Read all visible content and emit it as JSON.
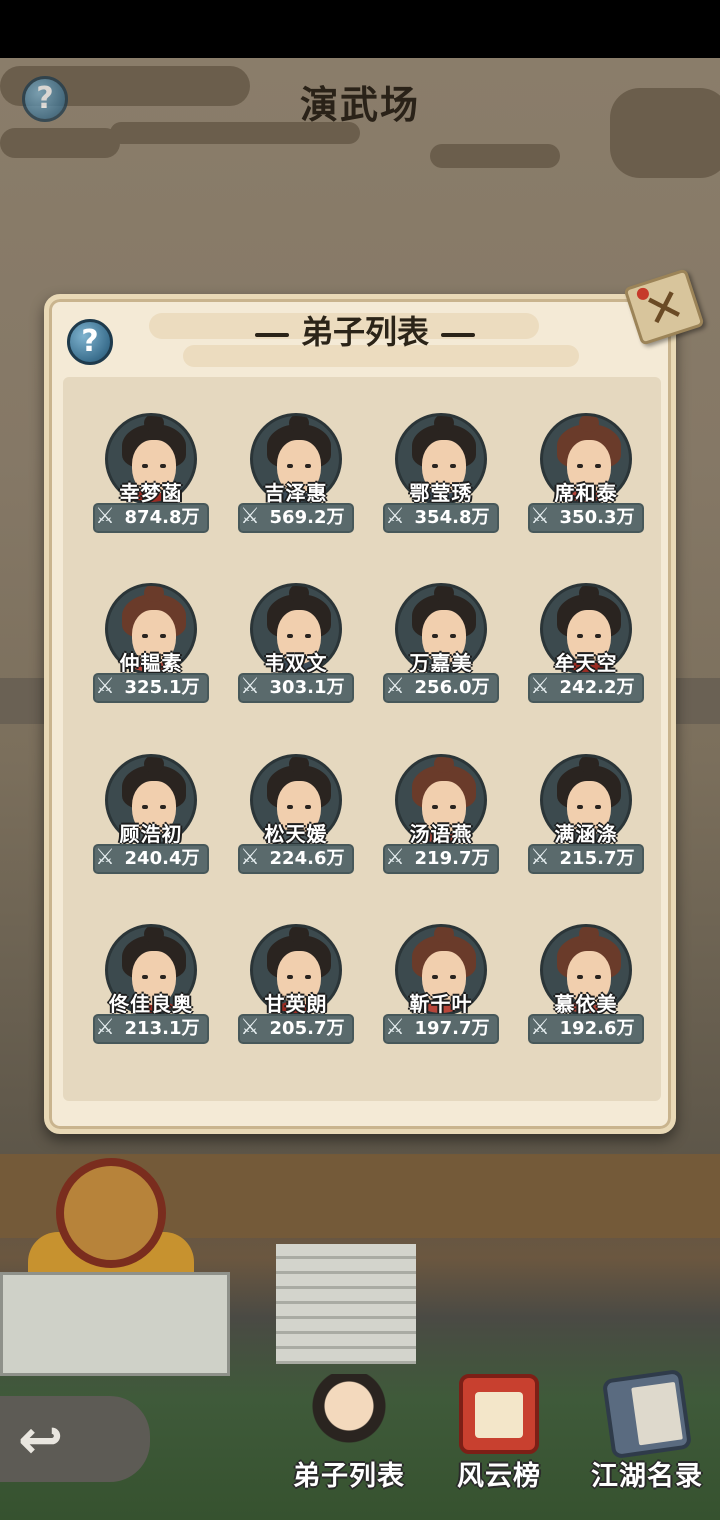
{
  "header": {
    "title": "演武场",
    "help_icon": "question-icon"
  },
  "panel": {
    "title": "弟子列表",
    "help_icon": "question-icon",
    "close_icon": "close-icon",
    "stat_icon": "crossed-swords-icon",
    "disciples": [
      {
        "name": "幸梦菡",
        "power": "874.8万",
        "avatar": "bearded-man"
      },
      {
        "name": "吉泽惠",
        "power": "569.2万",
        "avatar": "young-man"
      },
      {
        "name": "鄂莹琇",
        "power": "354.8万",
        "avatar": "young-man"
      },
      {
        "name": "席和泰",
        "power": "350.3万",
        "avatar": "girl-buns"
      },
      {
        "name": "仲韫素",
        "power": "325.1万",
        "avatar": "woman"
      },
      {
        "name": "韦双文",
        "power": "303.1万",
        "avatar": "young-man"
      },
      {
        "name": "万嘉美",
        "power": "256.0万",
        "avatar": "scholar"
      },
      {
        "name": "牟天空",
        "power": "242.2万",
        "avatar": "bearded-man"
      },
      {
        "name": "顾浩初",
        "power": "240.4万",
        "avatar": "swordsman"
      },
      {
        "name": "松天媛",
        "power": "224.6万",
        "avatar": "scholar"
      },
      {
        "name": "汤语燕",
        "power": "219.7万",
        "avatar": "girl-buns"
      },
      {
        "name": "满涵涤",
        "power": "215.7万",
        "avatar": "swordsman"
      },
      {
        "name": "佟佳良奥",
        "power": "213.1万",
        "avatar": "bearded-man"
      },
      {
        "name": "甘英朗",
        "power": "205.7万",
        "avatar": "bearded-man"
      },
      {
        "name": "靳千叶",
        "power": "197.7万",
        "avatar": "woman"
      },
      {
        "name": "慕依美",
        "power": "192.6万",
        "avatar": "girl-buns"
      }
    ]
  },
  "bottom_nav": {
    "back_icon": "back-arrow-icon",
    "items": [
      {
        "label": "弟子列表"
      },
      {
        "label": "风云榜"
      },
      {
        "label": "江湖名录"
      }
    ]
  }
}
